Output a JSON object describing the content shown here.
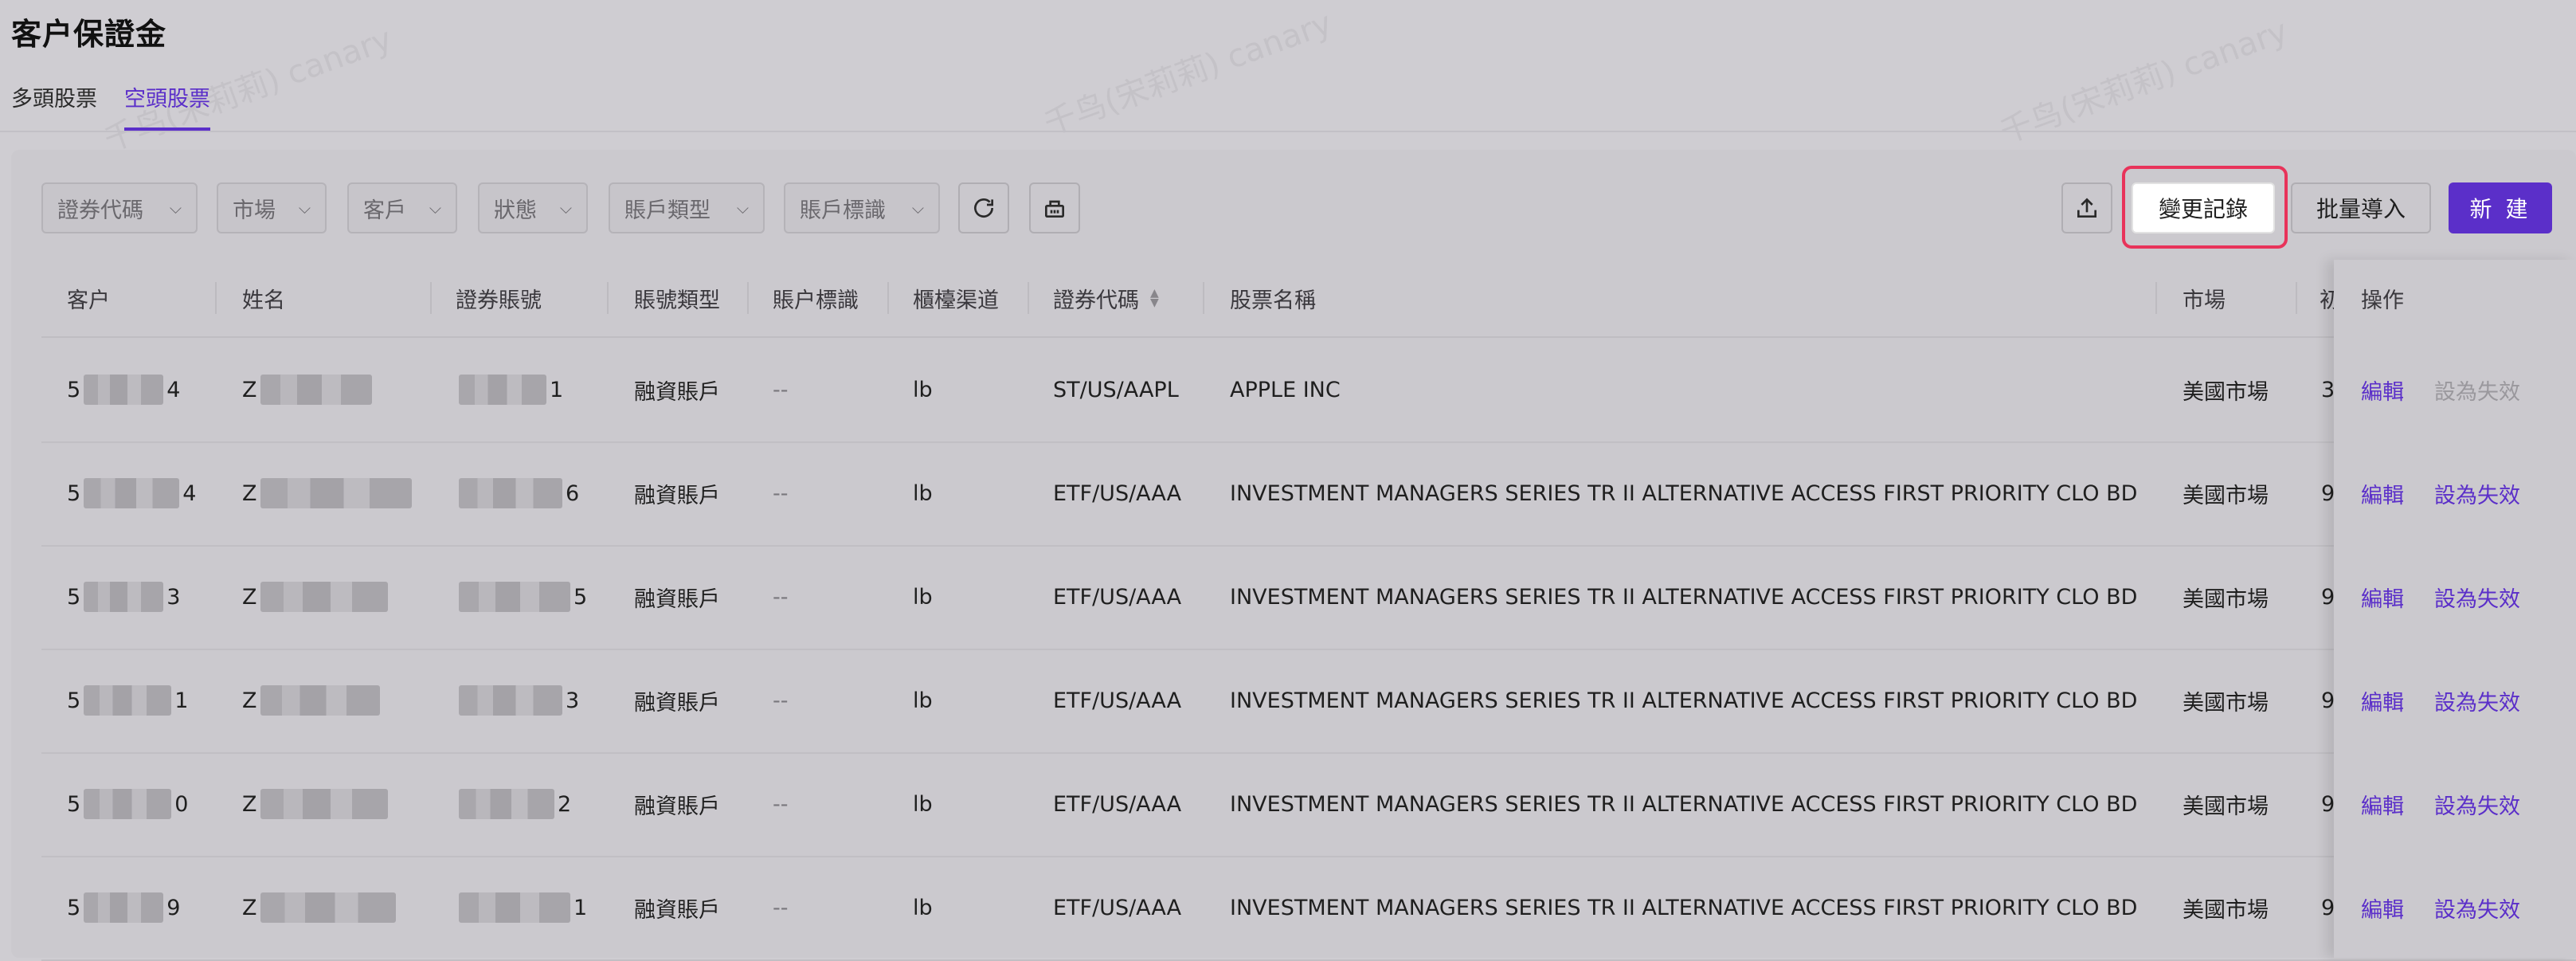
{
  "page": {
    "title": "客户保證金"
  },
  "tabs": [
    {
      "label": "多頭股票",
      "active": false
    },
    {
      "label": "空頭股票",
      "active": true
    }
  ],
  "filters": {
    "security_code": "證券代碼",
    "market": "市場",
    "client": "客戶",
    "status": "狀態",
    "account_type": "賬戶類型",
    "account_flag": "賬戶標識"
  },
  "toolbar": {
    "refresh_icon": "refresh-icon",
    "clear_icon": "basket-icon",
    "export_icon": "export-icon",
    "change_log_label": "變更記錄",
    "bulk_import_label": "批量導入",
    "new_label": "新 建"
  },
  "table": {
    "headers": {
      "client": "客户",
      "name": "姓名",
      "securities_account": "證券賬號",
      "account_type": "賬號類型",
      "account_flag": "賬户標識",
      "counter_channel": "櫃檯渠道",
      "security_code": "證券代碼",
      "stock_name": "股票名稱",
      "market": "市場",
      "partial": "初",
      "ops": "操作"
    },
    "rows": [
      {
        "client_prefix": "5",
        "client_suffix": "4",
        "name_prefix": "Z",
        "acct_suffix": "1",
        "account_type": "融資賬戶",
        "account_flag": "--",
        "channel": "lb",
        "code": "ST/US/AAPL",
        "stock": "APPLE INC",
        "market": "美國市場",
        "partial": "3",
        "edit": "編輯",
        "invalidate": "設為失效",
        "invalidate_enabled": false
      },
      {
        "client_prefix": "5",
        "client_suffix": "4",
        "name_prefix": "Z",
        "acct_suffix": "6",
        "account_type": "融資賬戶",
        "account_flag": "--",
        "channel": "lb",
        "code": "ETF/US/AAA",
        "stock": "INVESTMENT MANAGERS SERIES TR II ALTERNATIVE ACCESS FIRST PRIORITY CLO BD",
        "market": "美國市場",
        "partial": "9",
        "edit": "編輯",
        "invalidate": "設為失效",
        "invalidate_enabled": true
      },
      {
        "client_prefix": "5",
        "client_suffix": "3",
        "name_prefix": "Z",
        "acct_suffix": "5",
        "account_type": "融資賬戶",
        "account_flag": "--",
        "channel": "lb",
        "code": "ETF/US/AAA",
        "stock": "INVESTMENT MANAGERS SERIES TR II ALTERNATIVE ACCESS FIRST PRIORITY CLO BD",
        "market": "美國市場",
        "partial": "9",
        "edit": "編輯",
        "invalidate": "設為失效",
        "invalidate_enabled": true
      },
      {
        "client_prefix": "5",
        "client_suffix": "1",
        "name_prefix": "Z",
        "acct_suffix": "3",
        "account_type": "融資賬戶",
        "account_flag": "--",
        "channel": "lb",
        "code": "ETF/US/AAA",
        "stock": "INVESTMENT MANAGERS SERIES TR II ALTERNATIVE ACCESS FIRST PRIORITY CLO BD",
        "market": "美國市場",
        "partial": "9",
        "edit": "編輯",
        "invalidate": "設為失效",
        "invalidate_enabled": true
      },
      {
        "client_prefix": "5",
        "client_suffix": "0",
        "name_prefix": "Z",
        "acct_suffix": "2",
        "account_type": "融資賬戶",
        "account_flag": "--",
        "channel": "lb",
        "code": "ETF/US/AAA",
        "stock": "INVESTMENT MANAGERS SERIES TR II ALTERNATIVE ACCESS FIRST PRIORITY CLO BD",
        "market": "美國市場",
        "partial": "9",
        "edit": "編輯",
        "invalidate": "設為失效",
        "invalidate_enabled": true
      },
      {
        "client_prefix": "5",
        "client_suffix": "9",
        "name_prefix": "Z",
        "acct_suffix": "1",
        "account_type": "融資賬戶",
        "account_flag": "--",
        "channel": "lb",
        "code": "ETF/US/AAA",
        "stock": "INVESTMENT MANAGERS SERIES TR II ALTERNATIVE ACCESS FIRST PRIORITY CLO BD",
        "market": "美國市場",
        "partial": "9",
        "edit": "編輯",
        "invalidate": "設為失效",
        "invalidate_enabled": true
      }
    ]
  },
  "watermark": {
    "text": "千鸟(宋莉莉) canary"
  },
  "colors": {
    "accent": "#5b2fc9",
    "highlight": "#e8335a",
    "disabled": "#9a989d"
  }
}
